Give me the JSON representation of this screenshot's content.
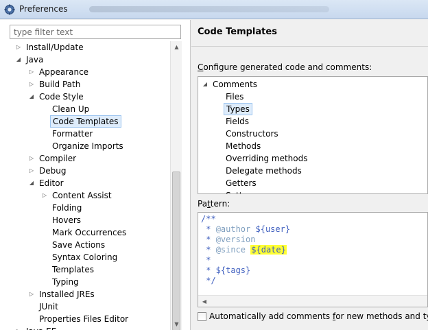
{
  "window": {
    "title": "Preferences"
  },
  "filter": {
    "placeholder": "type filter text",
    "value": ""
  },
  "nav_tree": [
    {
      "label": "Install/Update",
      "depth": 0,
      "expander": "collapsed"
    },
    {
      "label": "Java",
      "depth": 0,
      "expander": "expanded"
    },
    {
      "label": "Appearance",
      "depth": 1,
      "expander": "collapsed"
    },
    {
      "label": "Build Path",
      "depth": 1,
      "expander": "collapsed"
    },
    {
      "label": "Code Style",
      "depth": 1,
      "expander": "expanded"
    },
    {
      "label": "Clean Up",
      "depth": 2,
      "expander": "none"
    },
    {
      "label": "Code Templates",
      "depth": 2,
      "expander": "none",
      "selected": true
    },
    {
      "label": "Formatter",
      "depth": 2,
      "expander": "none"
    },
    {
      "label": "Organize Imports",
      "depth": 2,
      "expander": "none"
    },
    {
      "label": "Compiler",
      "depth": 1,
      "expander": "collapsed"
    },
    {
      "label": "Debug",
      "depth": 1,
      "expander": "collapsed"
    },
    {
      "label": "Editor",
      "depth": 1,
      "expander": "expanded"
    },
    {
      "label": "Content Assist",
      "depth": 2,
      "expander": "collapsed"
    },
    {
      "label": "Folding",
      "depth": 2,
      "expander": "none"
    },
    {
      "label": "Hovers",
      "depth": 2,
      "expander": "none"
    },
    {
      "label": "Mark Occurrences",
      "depth": 2,
      "expander": "none"
    },
    {
      "label": "Save Actions",
      "depth": 2,
      "expander": "none"
    },
    {
      "label": "Syntax Coloring",
      "depth": 2,
      "expander": "none"
    },
    {
      "label": "Templates",
      "depth": 2,
      "expander": "none"
    },
    {
      "label": "Typing",
      "depth": 2,
      "expander": "none"
    },
    {
      "label": "Installed JREs",
      "depth": 1,
      "expander": "collapsed"
    },
    {
      "label": "JUnit",
      "depth": 1,
      "expander": "none"
    },
    {
      "label": "Properties Files Editor",
      "depth": 1,
      "expander": "none"
    },
    {
      "label": "Java EE",
      "depth": 0,
      "expander": "collapsed"
    }
  ],
  "page": {
    "title": "Code Templates",
    "configure_label_prefix": "",
    "configure_label_accel": "C",
    "configure_label_rest": "onfigure generated code and comments:",
    "pattern_label_prefix": "Pa",
    "pattern_label_accel": "t",
    "pattern_label_rest": "tern:",
    "auto_comments_prefix": "Automatically add comments ",
    "auto_comments_accel": "f",
    "auto_comments_rest": "or new methods and types"
  },
  "template_tree": [
    {
      "label": "Comments",
      "depth": 0,
      "expander": "expanded"
    },
    {
      "label": "Files",
      "depth": 1,
      "expander": "none"
    },
    {
      "label": "Types",
      "depth": 1,
      "expander": "none",
      "selected": true
    },
    {
      "label": "Fields",
      "depth": 1,
      "expander": "none"
    },
    {
      "label": "Constructors",
      "depth": 1,
      "expander": "none"
    },
    {
      "label": "Methods",
      "depth": 1,
      "expander": "none"
    },
    {
      "label": "Overriding methods",
      "depth": 1,
      "expander": "none"
    },
    {
      "label": "Delegate methods",
      "depth": 1,
      "expander": "none"
    },
    {
      "label": "Getters",
      "depth": 1,
      "expander": "none"
    },
    {
      "label": "Setters",
      "depth": 1,
      "expander": "none"
    }
  ],
  "pattern_code": {
    "l1": "/**",
    "l2_prefix": " * ",
    "l2_tag": "@author",
    "l2_rest": " ${user}",
    "l3_prefix": " * ",
    "l3_tag": "@version",
    "l4_prefix": " * ",
    "l4_tag": "@since",
    "l4_space": " ",
    "l4_hl": "${date}",
    "l5": " *",
    "l6": " * ${tags}",
    "l7": " */"
  },
  "auto_comments_checked": false,
  "colors": {
    "selection_bg": "#deecfb",
    "highlight": "#ffff33",
    "javadoc": "#3f5fbf",
    "javadoc_tag": "#7f9fbf"
  }
}
